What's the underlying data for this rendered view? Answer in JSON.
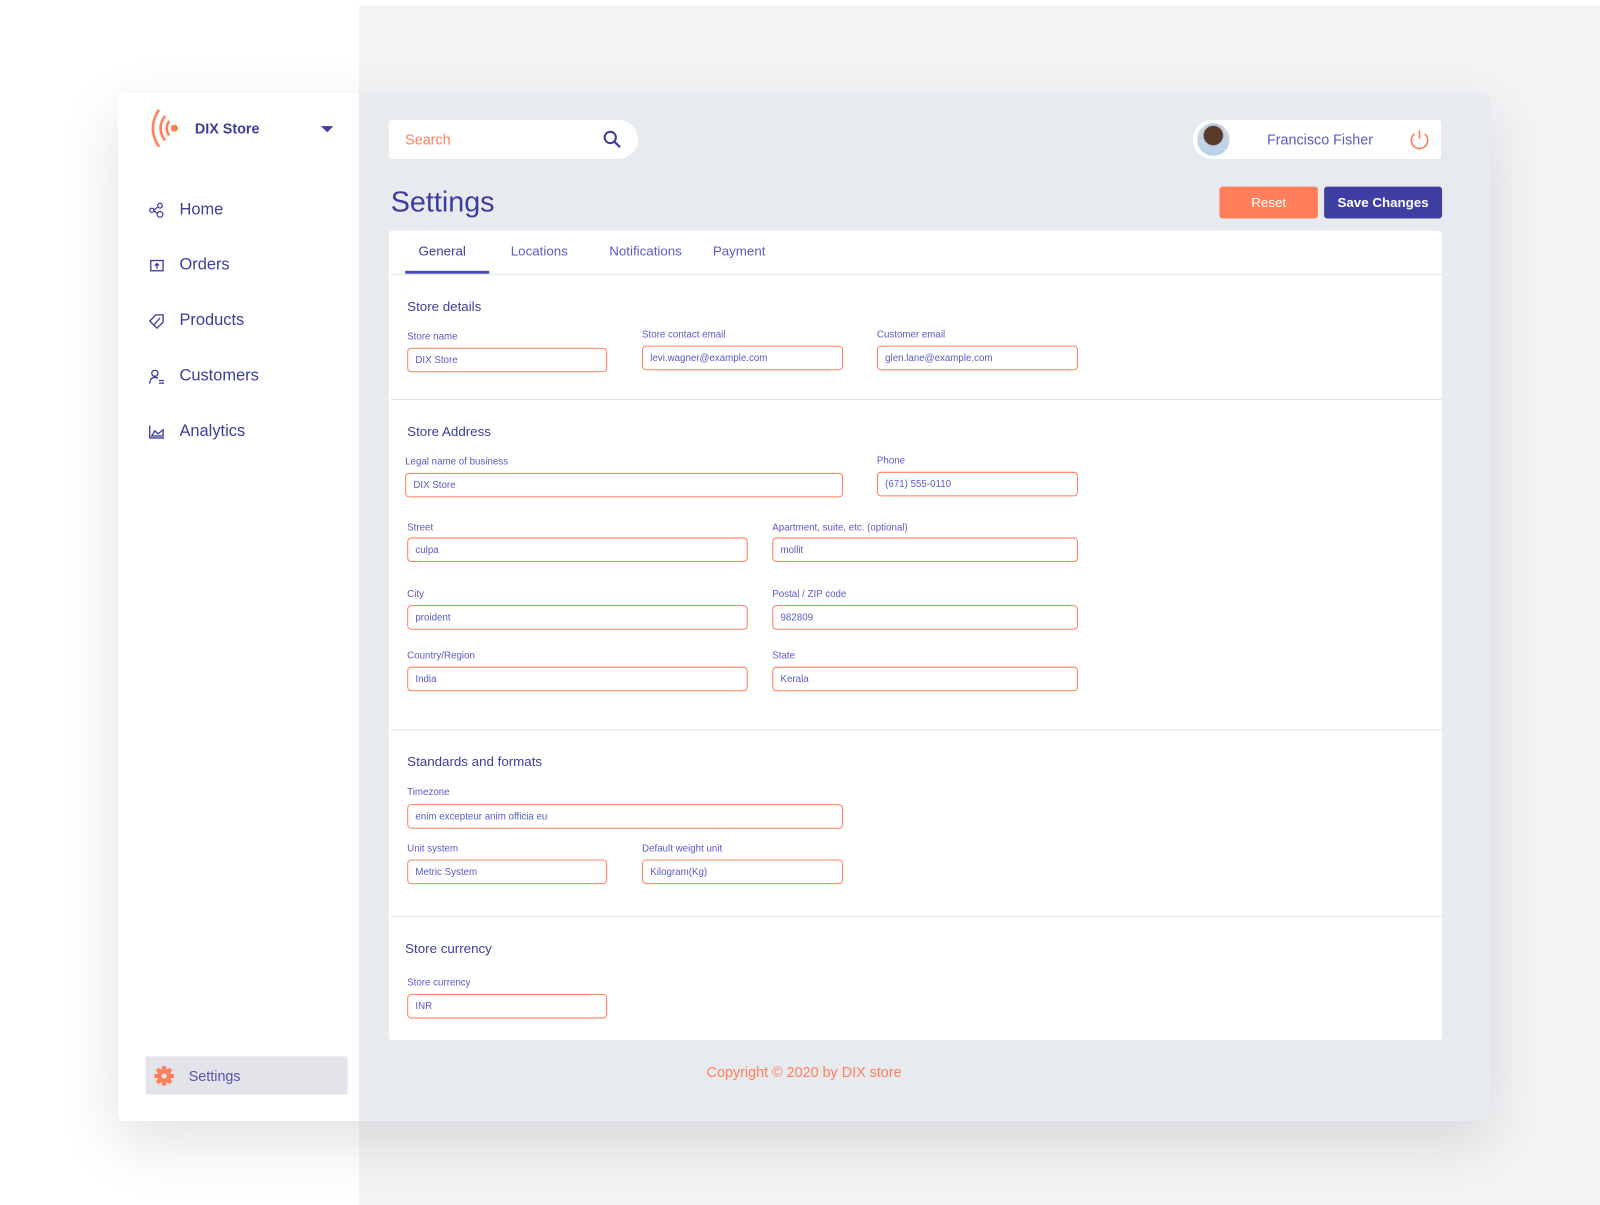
{
  "brand": {
    "name": "DIX Store"
  },
  "sidebar": {
    "items": [
      {
        "label": "Home",
        "icon": "share-nodes-icon"
      },
      {
        "label": "Orders",
        "icon": "box-upload-icon"
      },
      {
        "label": "Products",
        "icon": "tag-icon"
      },
      {
        "label": "Customers",
        "icon": "user-swap-icon"
      },
      {
        "label": "Analytics",
        "icon": "chart-area-icon"
      }
    ],
    "settings": {
      "label": "Settings",
      "icon": "gear-icon"
    }
  },
  "header": {
    "search_placeholder": "Search",
    "user_name": "Francisco Fisher"
  },
  "page": {
    "title": "Settings",
    "reset_label": "Reset",
    "save_label": "Save Changes"
  },
  "tabs": [
    {
      "label": "General",
      "active": true
    },
    {
      "label": "Locations"
    },
    {
      "label": "Notifications"
    },
    {
      "label": "Payment"
    }
  ],
  "sections": {
    "store_details": {
      "title": "Store details",
      "store_name": {
        "label": "Store name",
        "value": "DIX Store"
      },
      "contact_email": {
        "label": "Store contact email",
        "value": "levi.wagner@example.com"
      },
      "customer_email": {
        "label": "Customer email",
        "value": "glen.lane@example.com"
      }
    },
    "address": {
      "title": "Store Address",
      "legal_name": {
        "label": "Legal name of business",
        "value": "DIX Store"
      },
      "phone": {
        "label": "Phone",
        "value": "(671) 555-0110"
      },
      "street": {
        "label": "Street",
        "value": "culpa"
      },
      "apartment": {
        "label": "Apartment, suite, etc. (optional)",
        "value": "mollit"
      },
      "city": {
        "label": "City",
        "value": "proident"
      },
      "postal": {
        "label": "Postal / ZIP code",
        "value": "982809"
      },
      "country": {
        "label": "Country/Region",
        "value": "India"
      },
      "state": {
        "label": "State",
        "value": "Kerala"
      }
    },
    "standards": {
      "title": "Standards and formats",
      "timezone": {
        "label": "Timezone",
        "value": "enim excepteur anim officia eu"
      },
      "unit_system": {
        "label": "Unit system",
        "value": "Metric System"
      },
      "weight_unit": {
        "label": "Default weight unit",
        "value": "Kilogram(Kg)"
      }
    },
    "currency": {
      "title": "Store currency",
      "store_currency": {
        "label": "Store currency",
        "value": "INR"
      }
    }
  },
  "footer": {
    "copyright": "Copyright © 2020 by DIX store"
  },
  "colors": {
    "primary": "#3f3fa3",
    "accent": "#ff7f5c",
    "background": "#e7eaee"
  }
}
